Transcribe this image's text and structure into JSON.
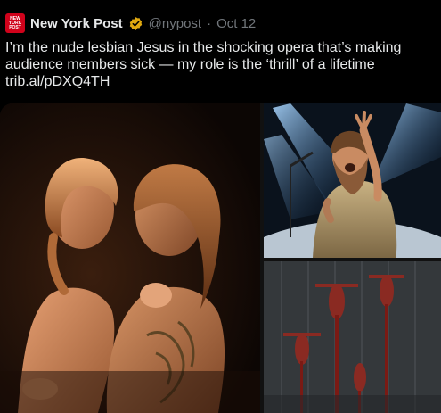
{
  "tweet": {
    "avatar_text": "NEW YORK POST",
    "display_name": "New York Post",
    "handle": "@nypost",
    "separator": "·",
    "date": "Oct 12",
    "text_lines": [
      "I’m the nude lesbian Jesus in the shocking opera that’s making",
      "audience members sick — my role is the ‘thrill’ of a lifetime",
      "trib.al/pDXQ4TH"
    ]
  },
  "colors": {
    "background": "#000000",
    "text": "#e7e9ea",
    "muted": "#71767b",
    "brand": "#d0021b",
    "verified": "#e0a910"
  },
  "icons": {
    "verified": "verified-badge-icon"
  }
}
